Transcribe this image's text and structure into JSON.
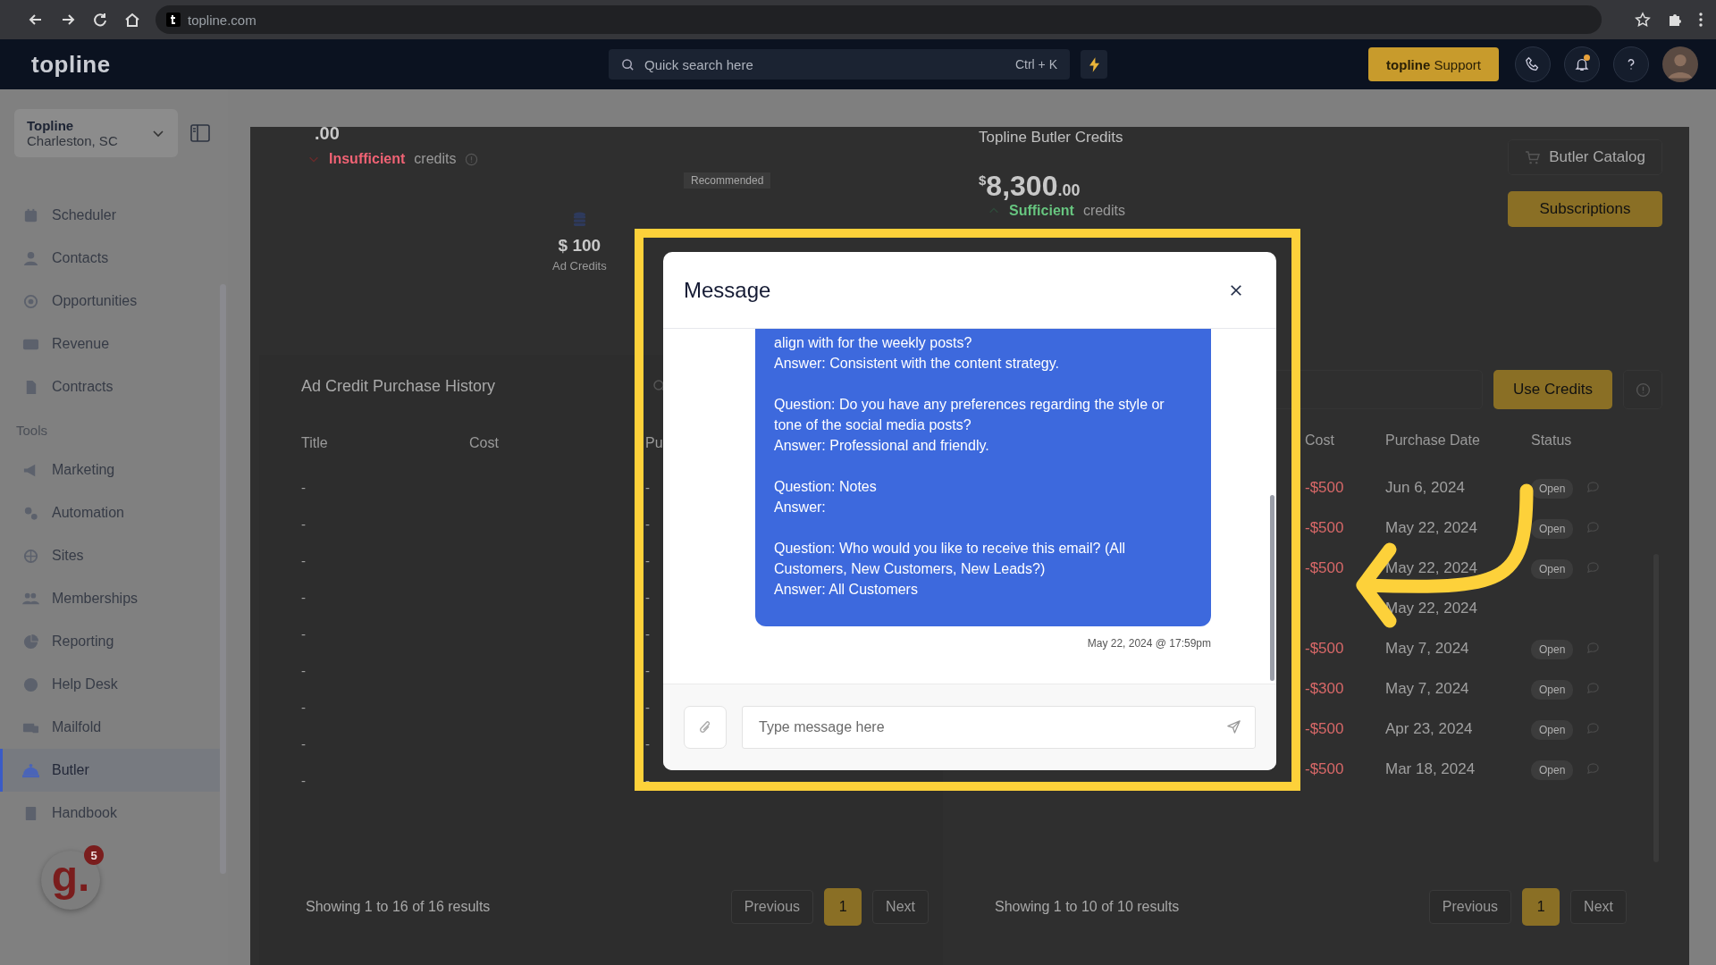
{
  "browser": {
    "url": "topline.com"
  },
  "header": {
    "logo": "topline",
    "search": {
      "placeholder": "Quick search here",
      "shortcut": "Ctrl + K"
    },
    "support_button": "**topline** Support",
    "notifications": {
      "unread": true
    }
  },
  "sidebar": {
    "account": {
      "name": "Topline",
      "location": "Charleston, SC"
    },
    "items": [
      {
        "kind": "item",
        "label": "Scheduler",
        "selected": false
      },
      {
        "kind": "item",
        "label": "Contacts",
        "selected": false
      },
      {
        "kind": "item",
        "label": "Opportunities",
        "selected": false
      },
      {
        "kind": "item",
        "label": "Revenue",
        "selected": false
      },
      {
        "kind": "item",
        "label": "Contracts",
        "selected": false
      },
      {
        "kind": "heading",
        "label": "Tools"
      },
      {
        "kind": "item",
        "label": "Marketing",
        "selected": false
      },
      {
        "kind": "item",
        "label": "Automation",
        "selected": false
      },
      {
        "kind": "item",
        "label": "Sites",
        "selected": false
      },
      {
        "kind": "item",
        "label": "Memberships",
        "selected": false
      },
      {
        "kind": "item",
        "label": "Reporting",
        "selected": false
      },
      {
        "kind": "item",
        "label": "Help Desk",
        "selected": false
      },
      {
        "kind": "item",
        "label": "Mailfold",
        "selected": false
      },
      {
        "kind": "item",
        "label": "Butler",
        "selected": true
      },
      {
        "kind": "item",
        "label": "Handbook",
        "selected": false
      }
    ]
  },
  "widget": {
    "letter": "g.",
    "badge": "5"
  },
  "ad_credits": {
    "cents": ".00",
    "sufficient": false,
    "status": "Insufficient",
    "status_suffix": "credits",
    "recommended": "Recommended",
    "package": {
      "price": "$ 100",
      "label": "Ad Credits"
    }
  },
  "ad_history": {
    "title": "Ad Credit Purchase History",
    "columns": [
      "Title",
      "Cost",
      "Pu"
    ],
    "rows": [
      {
        "title": "-",
        "purchase": "-"
      },
      {
        "title": "-",
        "purchase": "-"
      },
      {
        "title": "-",
        "purchase": "-"
      },
      {
        "title": "-",
        "purchase": "-"
      },
      {
        "title": "-",
        "purchase": "-"
      },
      {
        "title": "-",
        "purchase": "-"
      },
      {
        "title": "-",
        "purchase": "-"
      },
      {
        "title": "-",
        "purchase": "-"
      },
      {
        "title": "-",
        "purchase": "-"
      }
    ],
    "summary": "Showing 1 to 16 of 16 results",
    "pagination": {
      "previous": "Previous",
      "pages": [
        {
          "label": "1",
          "selected": true
        }
      ],
      "next": "Next"
    }
  },
  "butler_credits": {
    "title": "Topline Butler Credits",
    "currency": "$",
    "amount": "8,300",
    "cents": ".00",
    "sufficient": true,
    "status": "Sufficient",
    "status_suffix": "credits",
    "catalog_button": "Butler Catalog",
    "subscriptions_button": "Subscriptions",
    "use_credits_button": "Use Credits"
  },
  "butler_history": {
    "columns": [
      "Cost",
      "Purchase Date",
      "Status"
    ],
    "rows": [
      {
        "cost": "-$500",
        "date": "Jun 6, 2024",
        "status": "Open"
      },
      {
        "cost": "-$500",
        "date": "May 22, 2024",
        "status": "Open"
      },
      {
        "cost": "-$500",
        "date": "May 22, 2024",
        "status": "Open"
      },
      {
        "date": "May 22, 2024"
      },
      {
        "cost": "-$500",
        "date": "May 7, 2024",
        "status": "Open"
      },
      {
        "cost": "-$300",
        "date": "May 7, 2024",
        "status": "Open"
      },
      {
        "cost": "-$500",
        "date": "Apr 23, 2024",
        "status": "Open"
      },
      {
        "cost": "-$500",
        "date": "Mar 18, 2024",
        "status": "Open"
      }
    ],
    "summary": "Showing 1 to 10 of 10 results",
    "pagination": {
      "previous": "Previous",
      "pages": [
        {
          "label": "1",
          "selected": true
        }
      ],
      "next": "Next"
    }
  },
  "modal": {
    "title": "Message",
    "message": "align with for the weekly posts?\nAnswer: Consistent with the content strategy.\n\nQuestion: Do you have any preferences regarding the style or tone of the social media posts?\nAnswer: Professional and friendly.\n\nQuestion: Notes\nAnswer:\n\nQuestion: Who would you like to receive this email? (All Customers, New Customers, New Leads?)\nAnswer: All Customers",
    "timestamp": "May 22, 2024 @ 17:59pm",
    "input": {
      "placeholder": "Type message here"
    }
  }
}
